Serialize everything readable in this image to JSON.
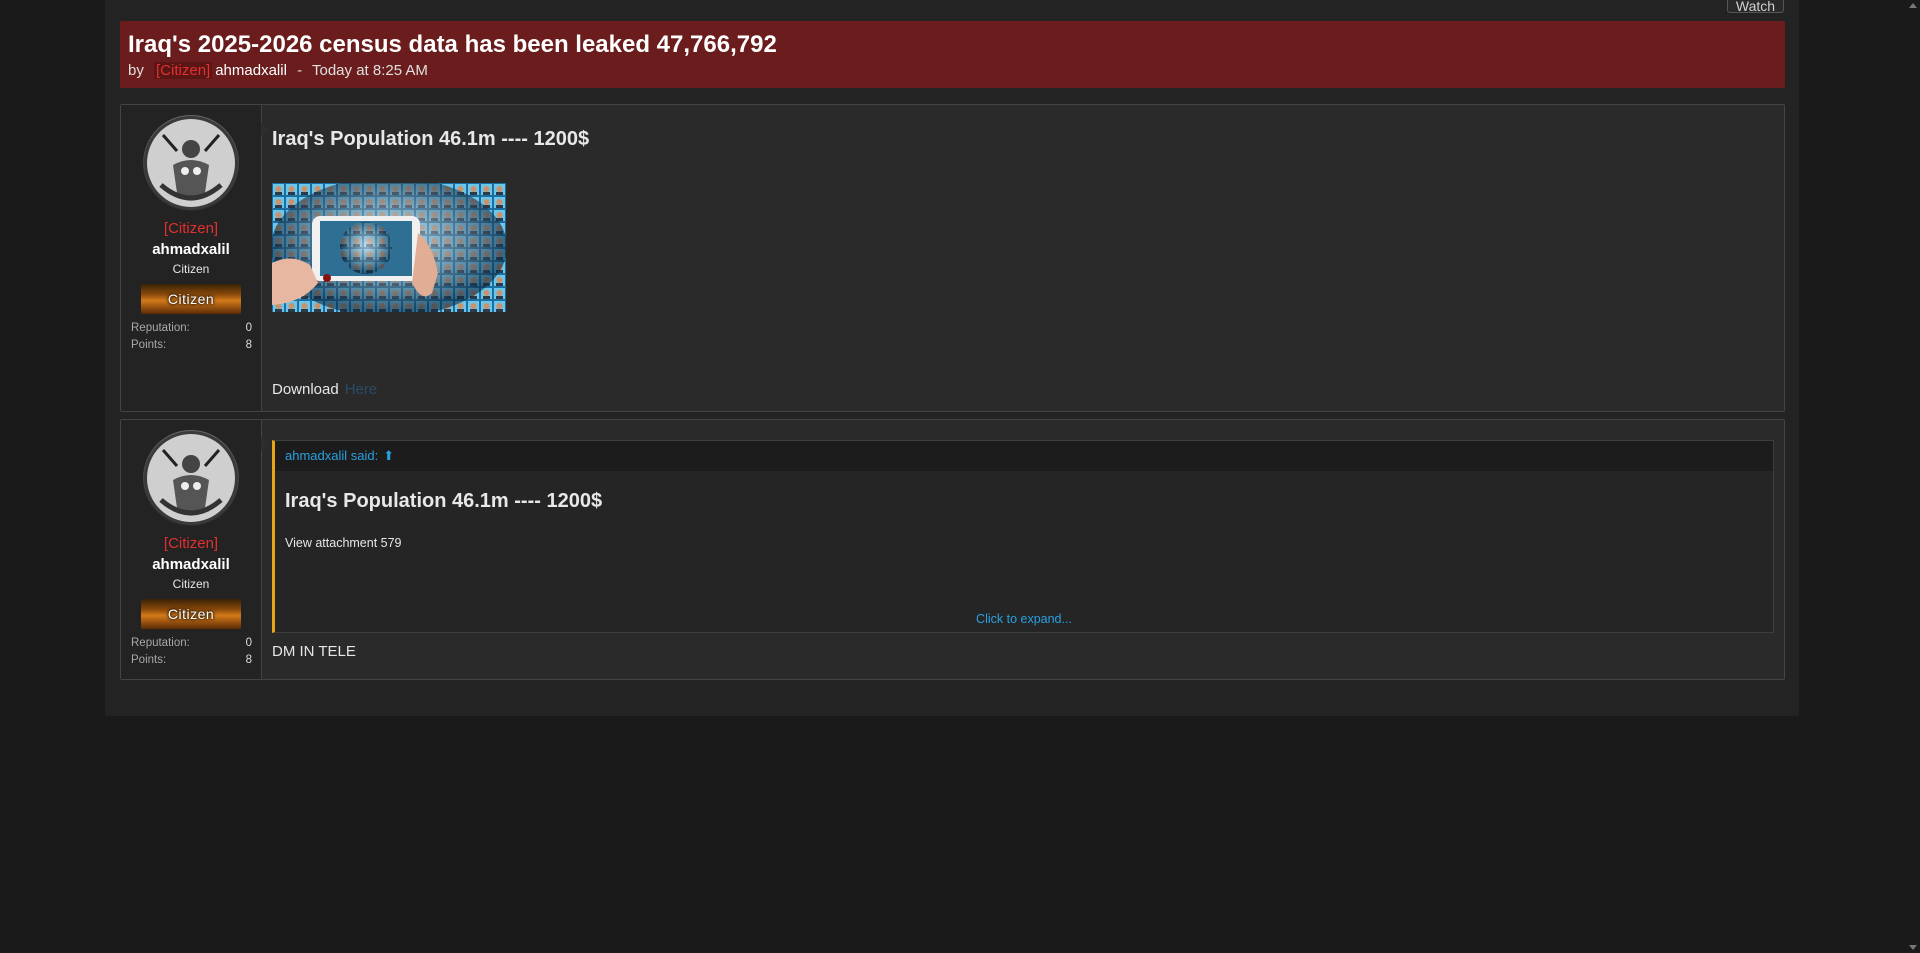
{
  "thread": {
    "watch_label": "Watch",
    "title": "Iraq's 2025-2026 census data has been leaked 47,766,792",
    "by": "by",
    "rank_tag": "[Citizen]",
    "author": "ahmadxalil",
    "separator": "-",
    "time": "Today at 8:25 AM"
  },
  "posts": [
    {
      "user": {
        "rank": "[Citizen]",
        "name": "ahmadxalil",
        "title": "Citizen",
        "banner": "Citizen",
        "stats": [
          {
            "label": "Reputation:",
            "value": "0"
          },
          {
            "label": "Points:",
            "value": "8"
          }
        ]
      },
      "heading": "Iraq's Population 46.1m ---- 1200$",
      "download_label": "Download",
      "download_link": "Here"
    },
    {
      "user": {
        "rank": "[Citizen]",
        "name": "ahmadxalil",
        "title": "Citizen",
        "banner": "Citizen",
        "stats": [
          {
            "label": "Reputation:",
            "value": "0"
          },
          {
            "label": "Points:",
            "value": "8"
          }
        ]
      },
      "quote": {
        "author_said": "ahmadxalil said:",
        "heading": "Iraq's Population 46.1m ---- 1200$",
        "attachment": "View attachment 579",
        "expand": "Click to expand..."
      },
      "reply": "DM IN TELE"
    }
  ],
  "colors": {
    "header_bg": "#6b1c1c",
    "rank_red": "#e23030",
    "link_blue": "#2aa0e0",
    "quote_accent": "#e8a317"
  }
}
